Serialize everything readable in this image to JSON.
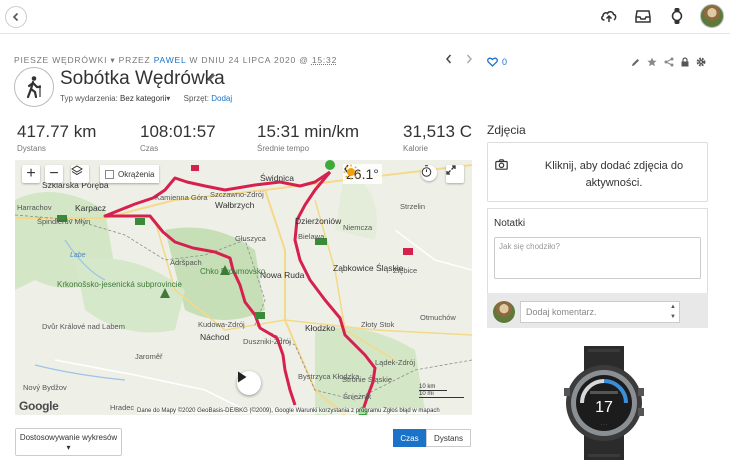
{
  "breadcrumb": {
    "category": "PIESZE WĘDRÓWKI",
    "by_prefix": "PRZEZ",
    "author": "PAWEL",
    "date_text": "W DNIU 24 LIPCA 2020 @",
    "time": "15:32"
  },
  "activity": {
    "title": "Sobótka Wędrówka",
    "event_type_label": "Typ wydarzenia:",
    "event_type_value": "Bez kategorii",
    "gear_label": "Sprzęt:",
    "gear_action": "Dodaj"
  },
  "likes": {
    "count": "0"
  },
  "stats": [
    {
      "value": "417.77 km",
      "label": "Dystans"
    },
    {
      "value": "108:01:57",
      "label": "Czas"
    },
    {
      "value": "15:31 min/km",
      "label": "Średnie tempo"
    },
    {
      "value": "31,513 C",
      "label": "Kalorie"
    }
  ],
  "map": {
    "okrazenia_label": "Okrążenia",
    "temperature": "26.1°",
    "attribution": "Dane do Mapy ©2020 GeoBasis-DE/BKG (©2009), Google   Warunki korzystania z programu   Zgłoś błąd w mapach",
    "google_logo": "Google",
    "scale_km": "10 km",
    "scale_mi": "10 mi",
    "labels": {
      "szklarska": "Szklarska Poręba",
      "karpacz": "Karpacz",
      "harrachov": "Harrachov",
      "spindler": "Špindlerův Mlýn",
      "kamienna": "Kamienna Góra",
      "szczawno": "Szczawno-Zdrój",
      "walbrzych": "Wałbrzych",
      "swidnica": "Świdnica",
      "dzierzoniow": "Dzierżoniów",
      "bielawa": "Bielawa",
      "niemcza": "Niemcza",
      "strzelin": "Strzelin",
      "gluszyca": "Głuszyca",
      "nowa_ruda": "Nowa Ruda",
      "zabkowice": "Ząbkowice Śląskie",
      "ziebice": "Ziębice",
      "adrspach": "Adršpach",
      "broumovsko": "Chko Broumovsko",
      "krkonose": "Krkonošsko-jesenická subprovincie",
      "dvur": "Dvůr Králové nad Labem",
      "kudowa": "Kudowa-Zdrój",
      "nachod": "Náchod",
      "duszniki": "Duszniki-Zdrój",
      "klodzko": "Kłodzko",
      "zloty_stok": "Złoty Stok",
      "otmuchow": "Otmuchów",
      "jaromer": "Jaroměř",
      "ladek": "Lądek-Zdrój",
      "bystrzyca": "Bystrzyca Kłodzka",
      "stronie": "Stronie Śląskie",
      "snieznik": "Śnieżnik",
      "hradec": "Hradec",
      "novy_bydzov": "Nový Bydžov",
      "labe": "Labe"
    }
  },
  "chart_controls": {
    "select_label": "Dostosowywanie wykresów",
    "time_label": "Czas",
    "distance_label": "Dystans"
  },
  "right": {
    "photos_title": "Zdjęcia",
    "photos_cta": "Kliknij, aby dodać zdjęcia do aktywności.",
    "notes_title": "Notatki",
    "notes_placeholder": "Jak się chodziło?",
    "comment_placeholder": "Dodaj komentarz."
  },
  "watch_display": {
    "value": "17"
  },
  "colors": {
    "accent": "#1a73c8",
    "route": "#d6204e",
    "map_bg": "#eef0e8",
    "park": "#c6dfb7"
  }
}
